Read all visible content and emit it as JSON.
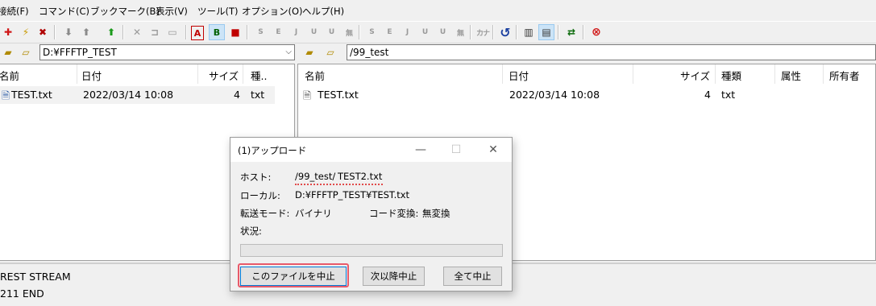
{
  "menu": [
    "接続(F)",
    "コマンド(C)",
    "ブックマーク(B)",
    "表示(V)",
    "ツール(T)",
    "オプション(O)",
    "ヘルプ(H)"
  ],
  "toolbar": {
    "text_buttons": [
      "S",
      "E",
      "J",
      "U",
      "U",
      "無",
      "S",
      "E",
      "J",
      "U",
      "U",
      "無",
      "カナ"
    ]
  },
  "local": {
    "path": "D:¥FFFTP_TEST",
    "columns": [
      "名前",
      "日付",
      "サイズ",
      "種.."
    ],
    "files": [
      {
        "name": "TEST.txt",
        "date": "2022/03/14 10:08",
        "size": "4",
        "type": "txt"
      }
    ]
  },
  "remote": {
    "path": "/99_test",
    "columns": [
      "名前",
      "日付",
      "サイズ",
      "種類",
      "属性",
      "所有者"
    ],
    "files": [
      {
        "name": "TEST.txt",
        "date": "2022/03/14 10:08",
        "size": "4",
        "type": "txt"
      }
    ]
  },
  "log": [
    "REST STREAM",
    "211 END"
  ],
  "dialog": {
    "title": "(1)アップロード",
    "host_label": "ホスト:",
    "host_dir": "/99_test/",
    "host_file": "TEST2.txt",
    "local_label": "ローカル:",
    "local_value": "D:¥FFFTP_TEST¥TEST.txt",
    "mode_label": "転送モード:",
    "mode_value": "バイナリ",
    "code_label": "コード変換:",
    "code_value": "無変換",
    "status_label": "状況:",
    "progress": 0,
    "buttons": {
      "cancel_file": "このファイルを中止",
      "cancel_from_next": "次以降中止",
      "cancel_all": "全て中止"
    }
  }
}
